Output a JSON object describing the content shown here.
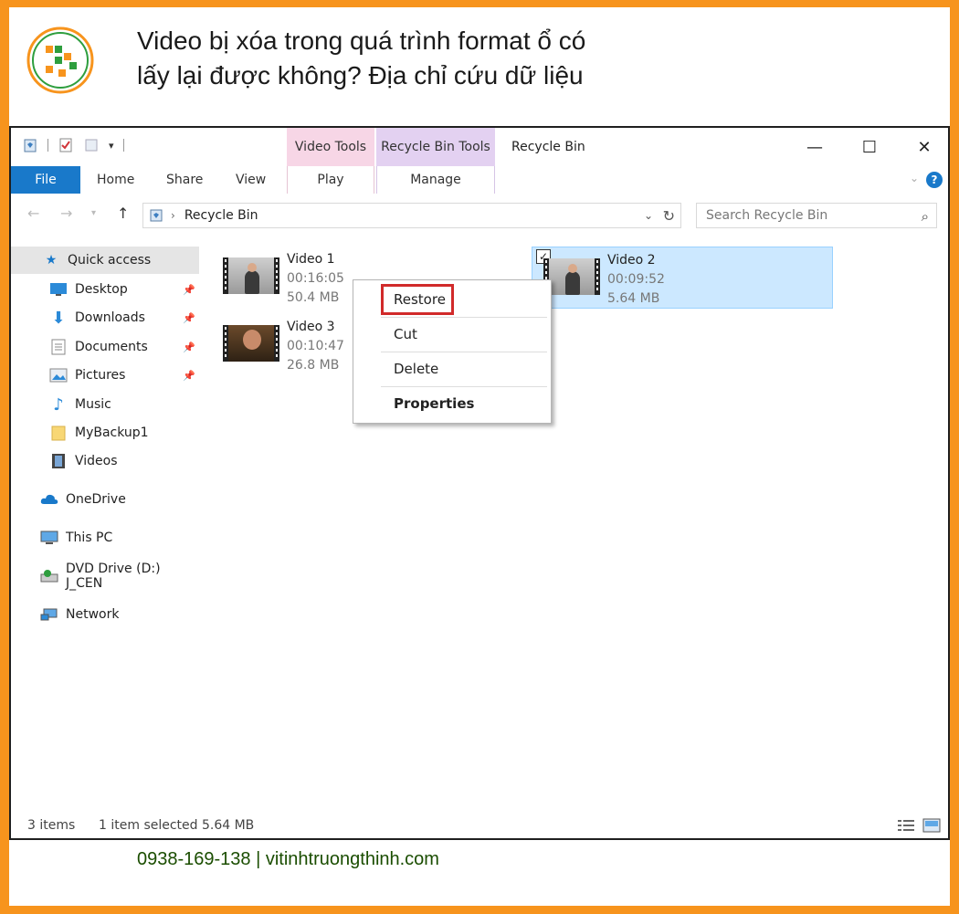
{
  "banner": {
    "title_line1": "Video bị xóa trong quá trình format ổ có",
    "title_line2": "lấy lại được không? Địa chỉ cứu dữ liệu",
    "footer": "0938-169-138 | vitinhtruongthinh.com"
  },
  "window": {
    "title": "Recycle Bin",
    "context_tabs": {
      "video_tools": "Video Tools",
      "recycle_bin_tools": "Recycle Bin Tools"
    },
    "tabs": {
      "file": "File",
      "home": "Home",
      "share": "Share",
      "view": "View",
      "play": "Play",
      "manage": "Manage"
    },
    "controls": {
      "minimize": "—",
      "maximize": "☐",
      "close": "✕"
    }
  },
  "address": {
    "path": "Recycle Bin",
    "search_placeholder": "Search Recycle Bin"
  },
  "nav": {
    "quick_access": "Quick access",
    "desktop": "Desktop",
    "downloads": "Downloads",
    "documents": "Documents",
    "pictures": "Pictures",
    "music": "Music",
    "mybackup": "MyBackup1",
    "videos": "Videos",
    "onedrive": "OneDrive",
    "thispc": "This PC",
    "dvd": "DVD Drive (D:) J_CEN",
    "network": "Network"
  },
  "files": [
    {
      "name": "Video 1",
      "duration": "00:16:05",
      "size": "50.4 MB"
    },
    {
      "name": "Video 2",
      "duration": "00:09:52",
      "size": "5.64 MB"
    },
    {
      "name": "Video 3",
      "duration": "00:10:47",
      "size": "26.8 MB"
    }
  ],
  "context_menu": {
    "restore": "Restore",
    "cut": "Cut",
    "delete": "Delete",
    "properties": "Properties"
  },
  "status": {
    "count": "3 items",
    "selection": "1 item selected  5.64 MB"
  },
  "colors": {
    "accent": "#1979ca",
    "border_orange": "#f7941d",
    "highlight_red": "#d12a2a",
    "selection": "#cce8ff"
  }
}
